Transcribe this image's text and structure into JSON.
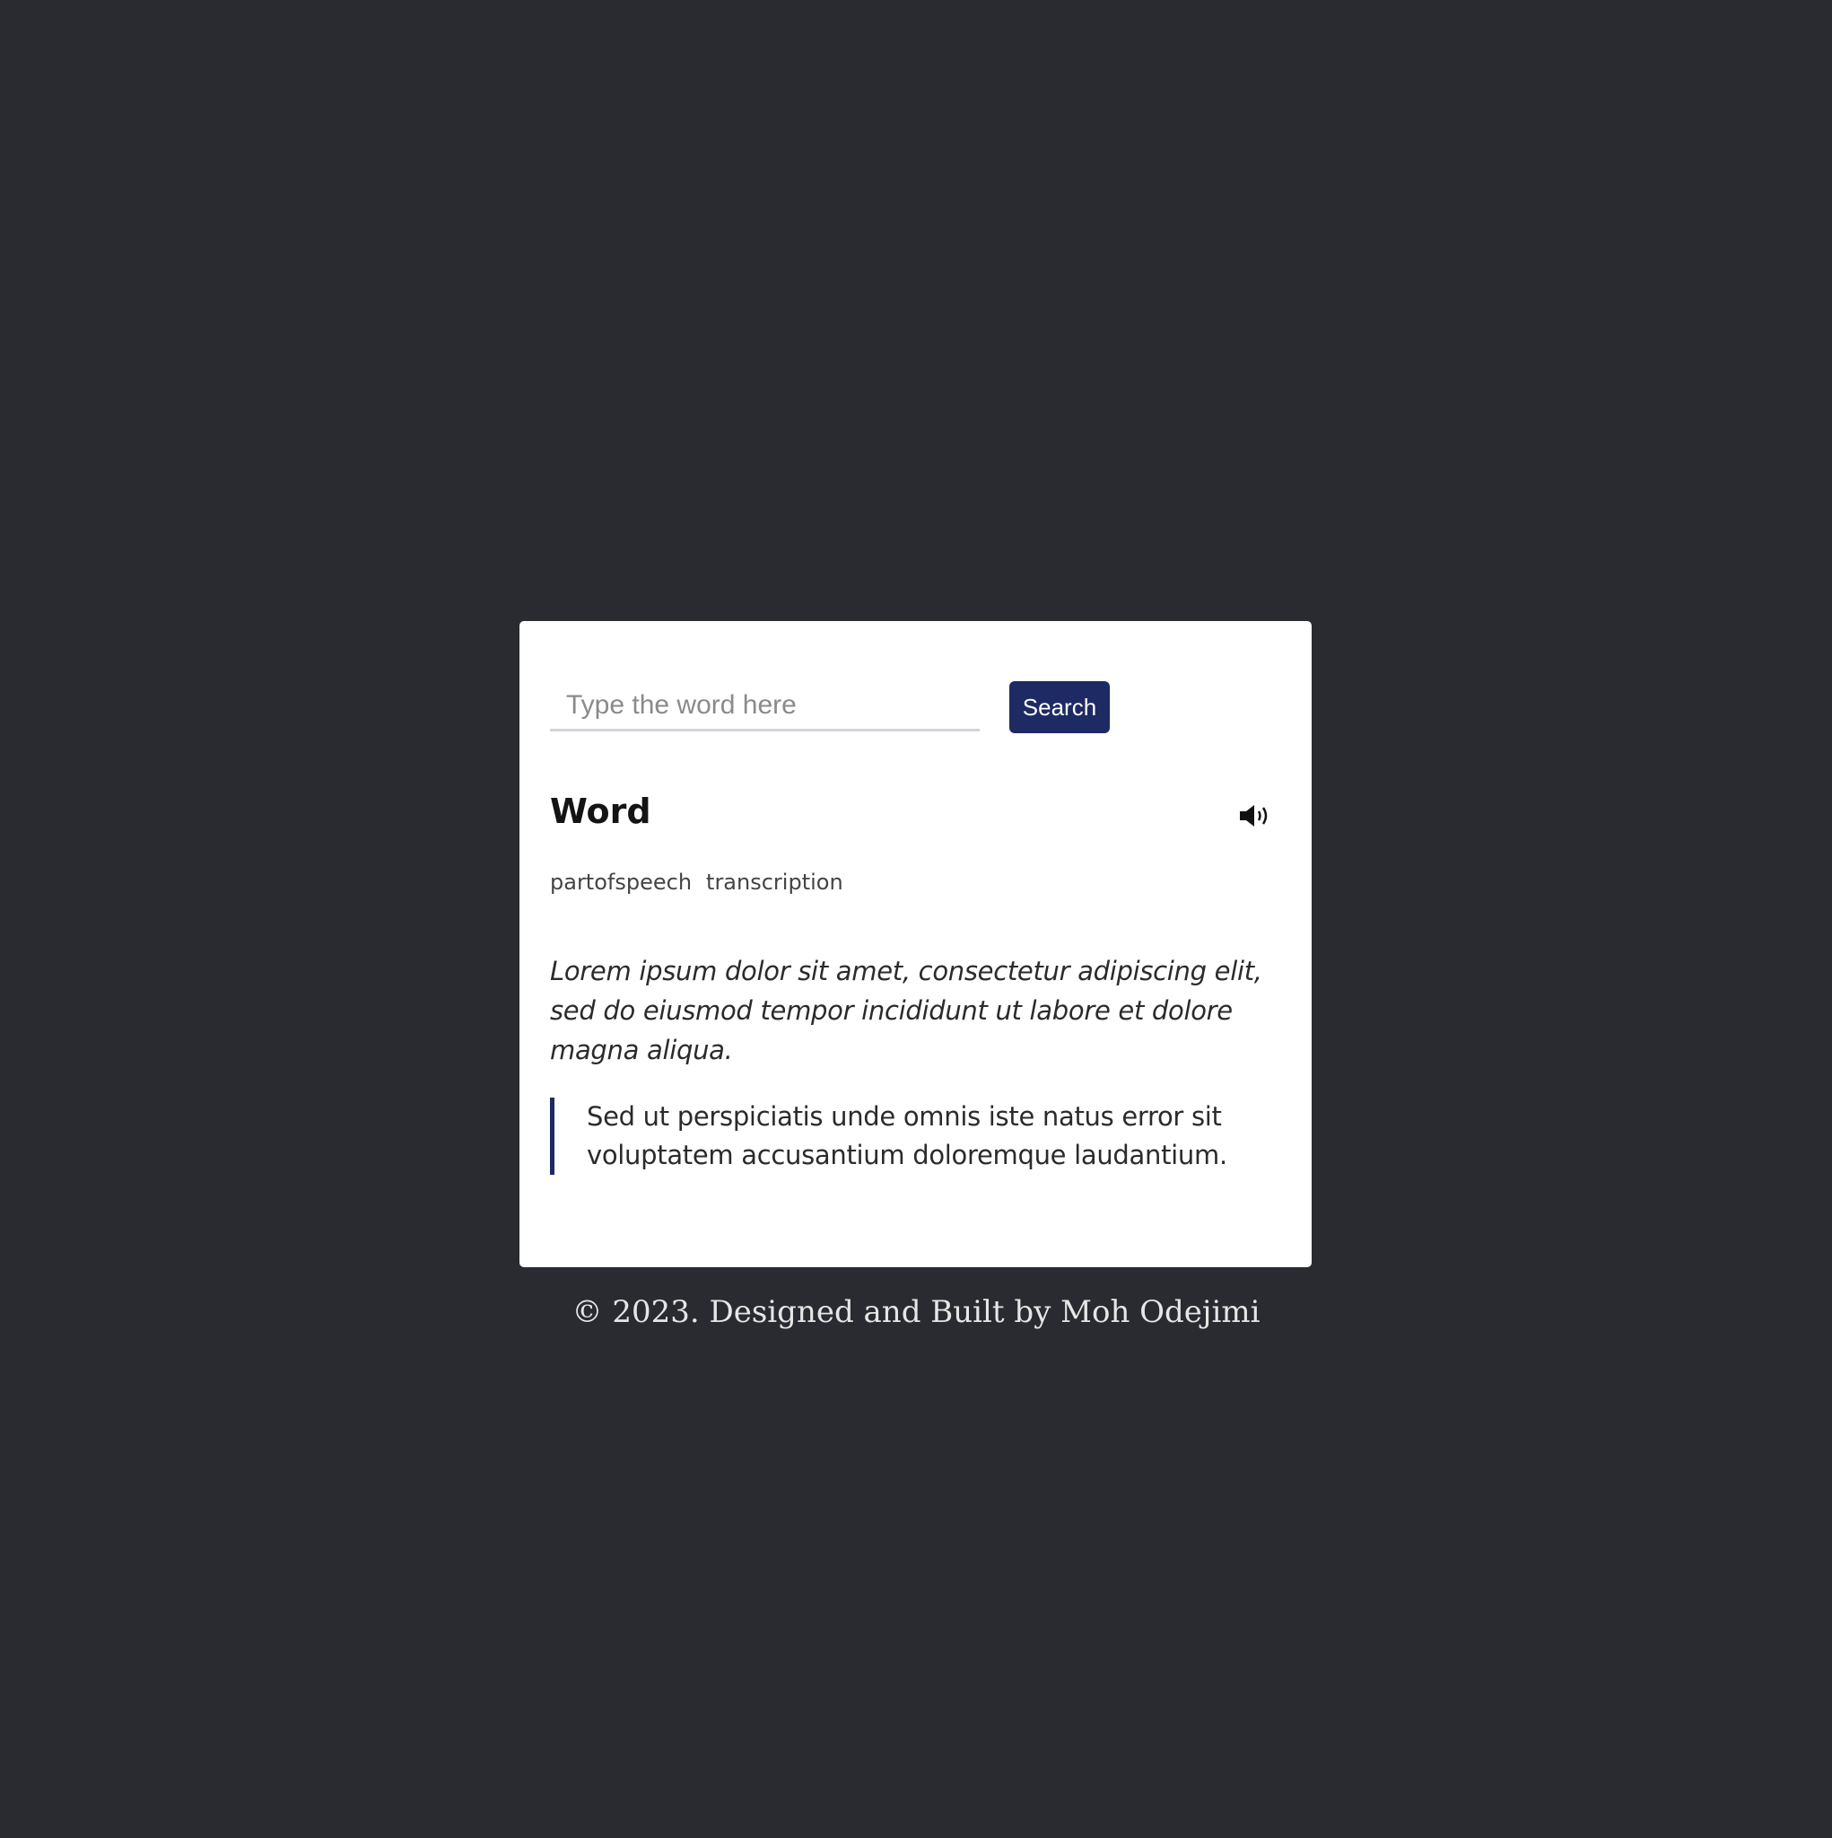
{
  "search": {
    "placeholder": "Type the word here",
    "value": "",
    "button_label": "Search"
  },
  "result": {
    "word": "Word",
    "part_of_speech": "partofspeech",
    "transcription": "transcription",
    "sound_icon": "speaker-icon",
    "definition": "Lorem ipsum dolor sit amet, consectetur adipiscing elit, sed do eiusmod tempor incididunt ut labore et dolore magna aliqua.",
    "example": "Sed ut perspiciatis unde omnis iste natus error sit voluptatem accusantium doloremque laudantium."
  },
  "footer": {
    "text": "© 2023. Designed and Built by Moh Odejimi"
  },
  "colors": {
    "background": "#2a2b30",
    "card": "#ffffff",
    "accent": "#1e2a63"
  }
}
